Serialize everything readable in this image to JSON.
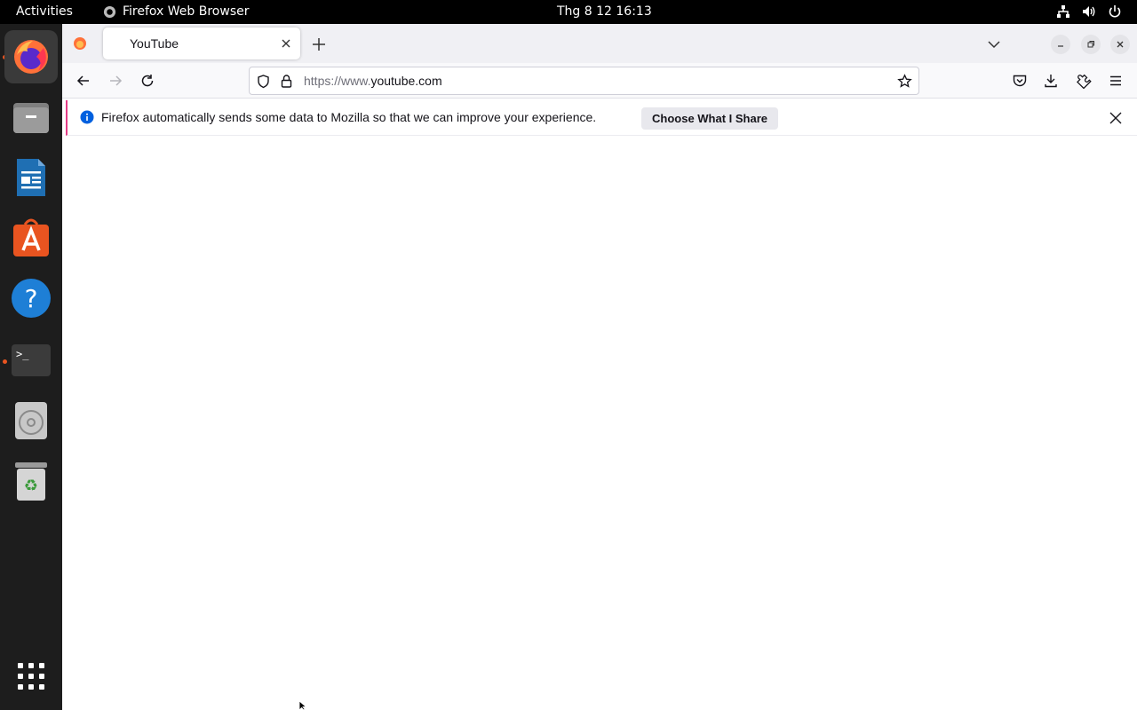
{
  "topbar": {
    "activities": "Activities",
    "app_name": "Firefox Web Browser",
    "clock": "Thg 8 12  16:13",
    "tray_icons": [
      "network-icon",
      "volume-icon",
      "power-icon"
    ]
  },
  "dock": {
    "items": [
      {
        "name": "firefox",
        "active": true,
        "running": true
      },
      {
        "name": "files"
      },
      {
        "name": "libreoffice-writer"
      },
      {
        "name": "app-center"
      },
      {
        "name": "help"
      },
      {
        "name": "terminal",
        "running": true
      },
      {
        "name": "disc-drive"
      },
      {
        "name": "trash"
      },
      {
        "name": "show-apps"
      }
    ]
  },
  "browser": {
    "tab": {
      "title": "YouTube"
    },
    "url": {
      "prefix": "https://www.",
      "domain": "youtube.com"
    },
    "notification": {
      "text": "Firefox automatically sends some data to Mozilla so that we can improve your experience.",
      "button": "Choose What I Share"
    }
  },
  "colors": {
    "accent": "#e95420",
    "notice_border": "#e53d87",
    "info_blue": "#0060df"
  }
}
